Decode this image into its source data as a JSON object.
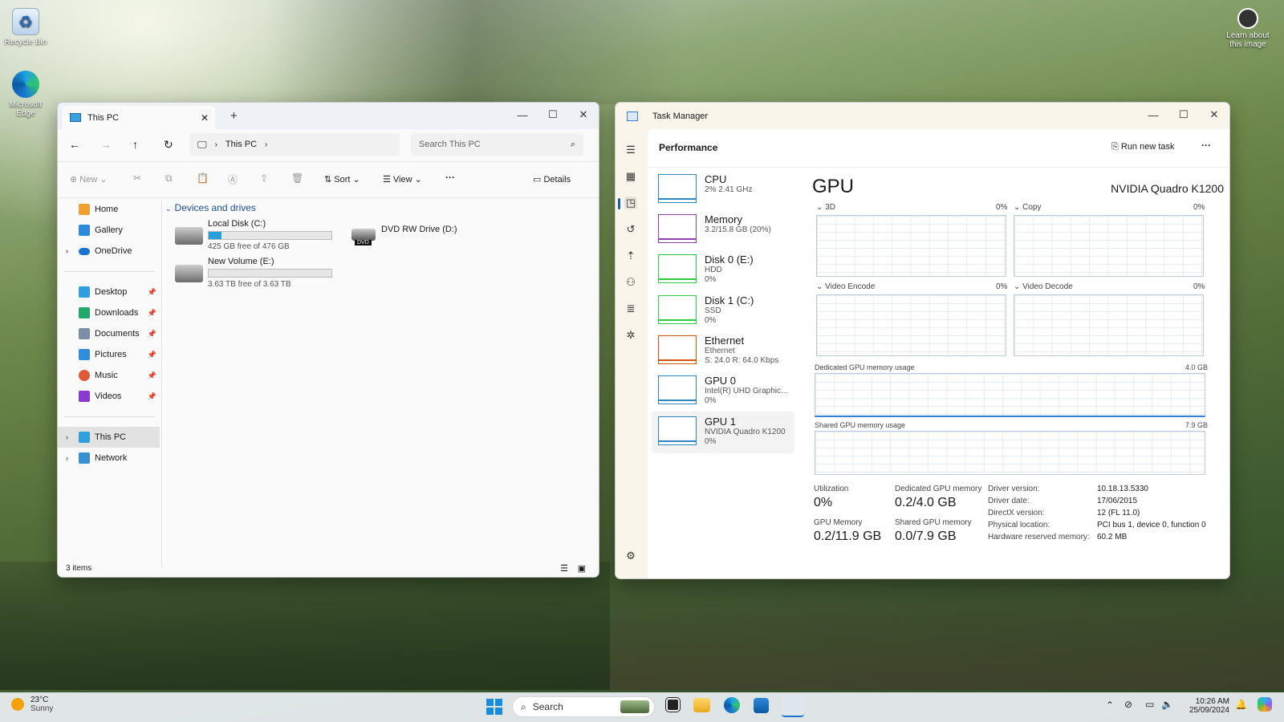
{
  "desktop": {
    "recycle_bin": "Recycle Bin",
    "edge": "Microsoft Edge",
    "learn_line1": "Learn about",
    "learn_line2": "this image"
  },
  "explorer": {
    "tab_title": "This PC",
    "breadcrumb": "This PC",
    "search_placeholder": "Search This PC",
    "toolbar": {
      "new": "New",
      "sort": "Sort",
      "view": "View",
      "details": "Details"
    },
    "nav": {
      "home": "Home",
      "gallery": "Gallery",
      "onedrive": "OneDrive",
      "desktop": "Desktop",
      "downloads": "Downloads",
      "documents": "Documents",
      "pictures": "Pictures",
      "music": "Music",
      "videos": "Videos",
      "this_pc": "This PC",
      "network": "Network"
    },
    "section": "Devices and drives",
    "drives": [
      {
        "name": "Local Disk (C:)",
        "free": "425 GB free of 476 GB",
        "used_fraction": 0.107
      },
      {
        "name": "DVD RW Drive (D:)",
        "badge": "DVD"
      },
      {
        "name": "New Volume (E:)",
        "free": "3.63 TB free of 3.63 TB",
        "used_fraction": 0.0
      }
    ],
    "status": "3 items"
  },
  "taskmgr": {
    "title": "Task Manager",
    "page": "Performance",
    "run_new_task": "Run new task",
    "items": [
      {
        "name": "CPU",
        "l1": "2% 2.41 GHz",
        "l2": ""
      },
      {
        "name": "Memory",
        "l1": "3.2/15.8 GB (20%)",
        "l2": ""
      },
      {
        "name": "Disk 0 (E:)",
        "l1": "HDD",
        "l2": "0%"
      },
      {
        "name": "Disk 1 (C:)",
        "l1": "SSD",
        "l2": "0%"
      },
      {
        "name": "Ethernet",
        "l1": "Ethernet",
        "l2": "S: 24.0  R: 64.0 Kbps"
      },
      {
        "name": "GPU 0",
        "l1": "Intel(R) UHD Graphic...",
        "l2": "0%"
      },
      {
        "name": "GPU 1",
        "l1": "NVIDIA Quadro K1200",
        "l2": "0%"
      }
    ],
    "gpu": {
      "heading": "GPU",
      "model": "NVIDIA Quadro K1200",
      "graphs": [
        {
          "label": "3D",
          "pct": "0%"
        },
        {
          "label": "Copy",
          "pct": "0%"
        },
        {
          "label": "Video Encode",
          "pct": "0%"
        },
        {
          "label": "Video Decode",
          "pct": "0%"
        }
      ],
      "dedicated_label": "Dedicated GPU memory usage",
      "dedicated_max": "4.0 GB",
      "shared_label": "Shared GPU memory usage",
      "shared_max": "7.9 GB",
      "stats": {
        "utilization_label": "Utilization",
        "utilization": "0%",
        "dedicated_label": "Dedicated GPU memory",
        "dedicated": "0.2/4.0 GB",
        "gpu_memory_label": "GPU Memory",
        "gpu_memory": "0.2/11.9 GB",
        "shared_label": "Shared GPU memory",
        "shared": "0.0/7.9 GB"
      },
      "info": [
        {
          "k": "Driver version:",
          "v": "10.18.13.5330"
        },
        {
          "k": "Driver date:",
          "v": "17/06/2015"
        },
        {
          "k": "DirectX version:",
          "v": "12 (FL 11.0)"
        },
        {
          "k": "Physical location:",
          "v": "PCI bus 1, device 0, function 0"
        },
        {
          "k": "Hardware reserved memory:",
          "v": "60.2 MB"
        }
      ]
    }
  },
  "taskbar": {
    "temp": "23°C",
    "weather": "Sunny",
    "search": "Search",
    "time": "10:26 AM",
    "date": "25/09/2024"
  }
}
